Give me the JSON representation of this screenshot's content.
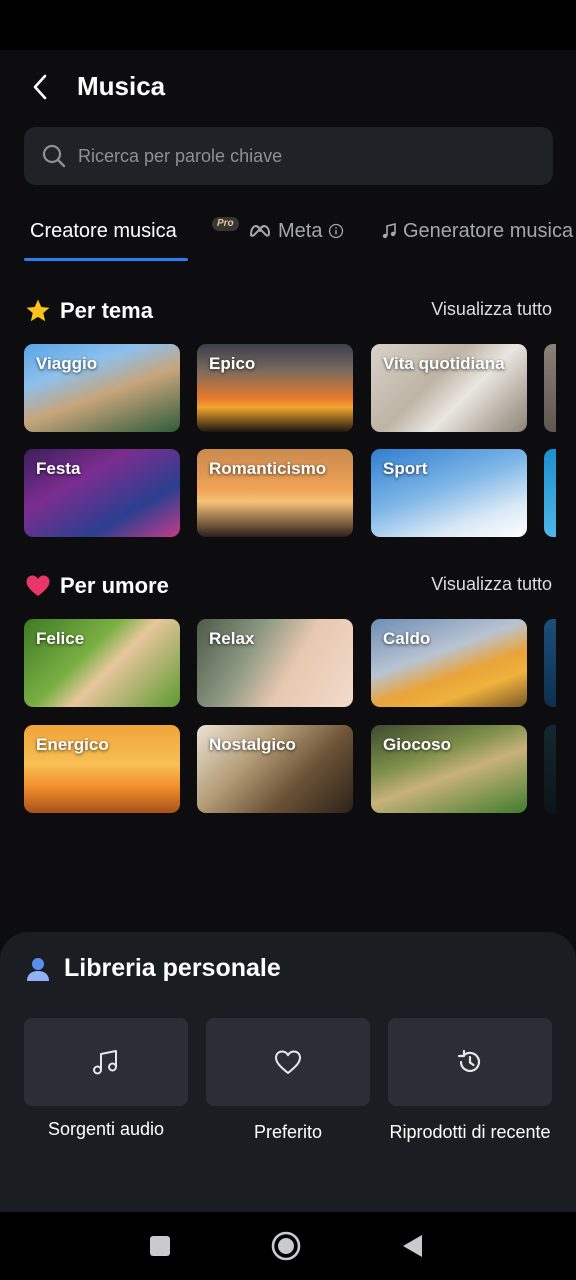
{
  "header": {
    "title": "Musica",
    "back_icon": "chevron-left-icon"
  },
  "search": {
    "placeholder": "Ricerca per parole chiave",
    "value": ""
  },
  "tabs": [
    {
      "label": "Creatore musica",
      "active": true
    },
    {
      "label": "Meta",
      "badge": "Pro",
      "icon": "meta-logo-icon",
      "info_icon": "info-icon"
    },
    {
      "label": "Generatore musica",
      "icon": "music-note-icon"
    }
  ],
  "sections": {
    "by_theme": {
      "title": "Per tema",
      "emoji": "star-icon",
      "view_all": "Visualizza tutto",
      "cards": [
        "Viaggio",
        "Epico",
        "Vita quotidiana",
        "Festa",
        "Romanticismo",
        "Sport"
      ]
    },
    "by_mood": {
      "title": "Per umore",
      "emoji": "heart-icon",
      "view_all": "Visualizza tutto",
      "cards": [
        "Felice",
        "Relax",
        "Caldo",
        "Energico",
        "Nostalgico",
        "Giocoso"
      ]
    }
  },
  "library": {
    "title": "Libreria personale",
    "icon": "user-icon",
    "items": [
      {
        "label": "Sorgenti audio",
        "icon": "music-note-icon"
      },
      {
        "label": "Preferito",
        "icon": "heart-outline-icon"
      },
      {
        "label": "Riprodotti di recente",
        "icon": "history-icon"
      }
    ]
  },
  "colors": {
    "accent": "#2f7cf6",
    "background": "#0d0d0f",
    "panel": "#1a1d21",
    "tile": "#2b2f35"
  }
}
